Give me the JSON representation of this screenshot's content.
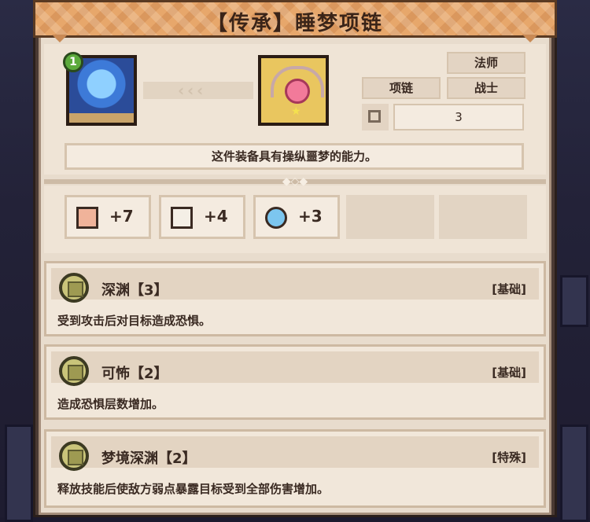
{
  "title": "【传承】睡梦项链",
  "hero": {
    "level": "1"
  },
  "item": {
    "slot": "项链",
    "classes": [
      "法师",
      "战士"
    ],
    "count": "3",
    "description": "这件装备具有操纵噩梦的能力。"
  },
  "stats": [
    {
      "icon": "fist-icon",
      "value": "+7"
    },
    {
      "icon": "book-icon",
      "value": "+4"
    },
    {
      "icon": "water-drop-icon",
      "value": "+3"
    }
  ],
  "skills": [
    {
      "name": "深渊【3】",
      "tag": "[基础]",
      "text": "受到攻击后对目标造成恐惧。"
    },
    {
      "name": "可怖【2】",
      "tag": "[基础]",
      "text": "造成恐惧层数增加。"
    },
    {
      "name": "梦境深渊【2】",
      "tag": "[特殊]",
      "text": "释放技能后使敌方弱点暴露目标受到全部伤害增加。"
    }
  ],
  "colors": {
    "accent": "#e7a76b",
    "panel": "#e8dccd",
    "text": "#3a2a22"
  }
}
